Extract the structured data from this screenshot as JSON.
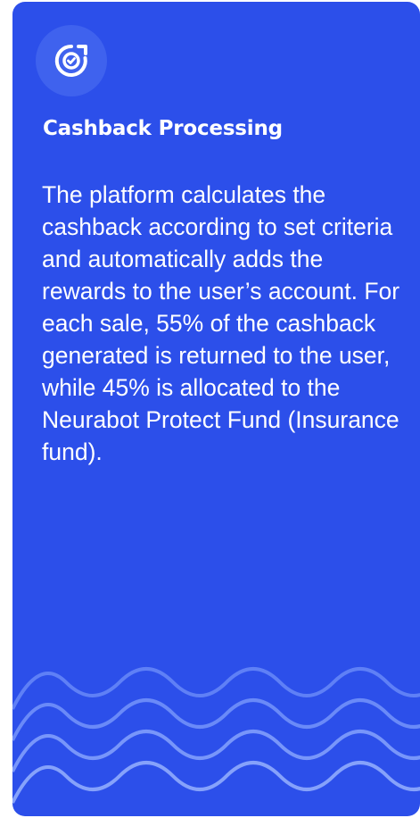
{
  "card": {
    "icon": "refresh-check-icon",
    "title": "Cashback Processing",
    "description": "The platform calculates the cashback according to set criteria and automatically adds the rewards to the user’s account. For each sale, 55% of the cashback generated is returned to the user, while 45% is allocated to the Neurabot Protect Fund (Insurance fund)."
  },
  "colors": {
    "card_background": "#2c4fea",
    "icon_circle": "#3f62ee",
    "text": "#ffffff",
    "wave_line": "#5f80f6"
  }
}
